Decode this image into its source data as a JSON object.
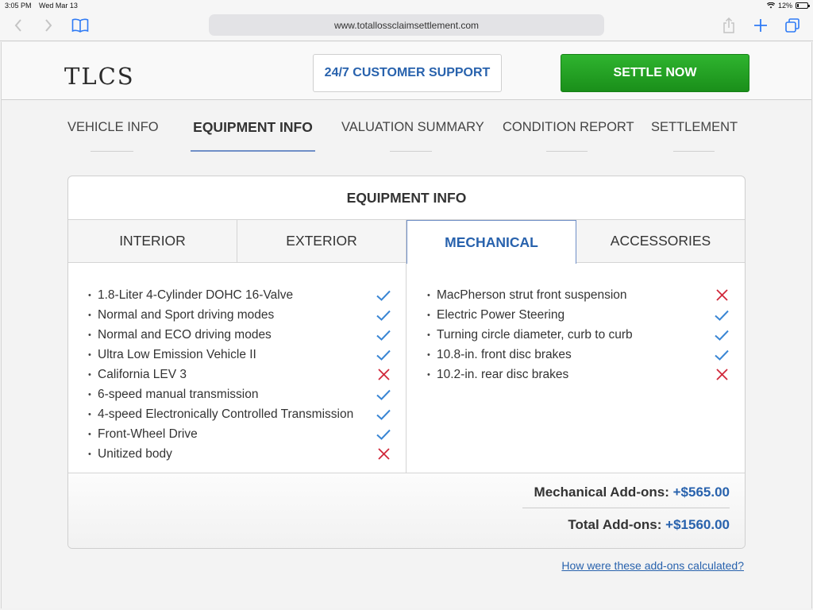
{
  "status_bar": {
    "time": "3:05 PM",
    "date": "Wed Mar 13",
    "battery": "12%",
    "battery_level": 0.12
  },
  "browser": {
    "url": "www.totallossclaimsettlement.com"
  },
  "header": {
    "logo": "TLCS",
    "support_label": "24/7 CUSTOMER SUPPORT",
    "settle_label": "SETTLE NOW"
  },
  "steps": [
    "VEHICLE INFO",
    "EQUIPMENT INFO",
    "VALUATION SUMMARY",
    "CONDITION REPORT",
    "SETTLEMENT"
  ],
  "active_step": "EQUIPMENT INFO",
  "card": {
    "title": "EQUIPMENT INFO",
    "tabs": [
      "INTERIOR",
      "EXTERIOR",
      "MECHANICAL",
      "ACCESSORIES"
    ],
    "active_tab": "MECHANICAL",
    "left_items": [
      {
        "label": "1.8-Liter 4-Cylinder DOHC 16-Valve",
        "included": true
      },
      {
        "label": "Normal and Sport driving modes",
        "included": true
      },
      {
        "label": "Normal and ECO driving modes",
        "included": true
      },
      {
        "label": "Ultra Low Emission Vehicle II",
        "included": true
      },
      {
        "label": "California LEV 3",
        "included": false
      },
      {
        "label": "6-speed manual transmission",
        "included": true
      },
      {
        "label": "4-speed Electronically Controlled Transmission",
        "included": true
      },
      {
        "label": "Front-Wheel Drive",
        "included": true
      },
      {
        "label": "Unitized body",
        "included": false
      }
    ],
    "right_items": [
      {
        "label": "MacPherson strut front suspension",
        "included": false
      },
      {
        "label": "Electric Power Steering",
        "included": true
      },
      {
        "label": "Turning circle diameter, curb to curb",
        "included": true
      },
      {
        "label": "10.8-in. front disc brakes",
        "included": true
      },
      {
        "label": "10.2-in. rear disc brakes",
        "included": false
      }
    ],
    "totals": {
      "mechanical_label": "Mechanical Add-ons:",
      "mechanical_value": "+$565.00",
      "total_label": "Total Add-ons:",
      "total_value": "+$1560.00"
    }
  },
  "help_link": "How were these add-ons calculated?",
  "colors": {
    "accent": "#2862ad",
    "check": "#3a86d4",
    "cross": "#d0283a",
    "settle_green": "#22a322"
  }
}
